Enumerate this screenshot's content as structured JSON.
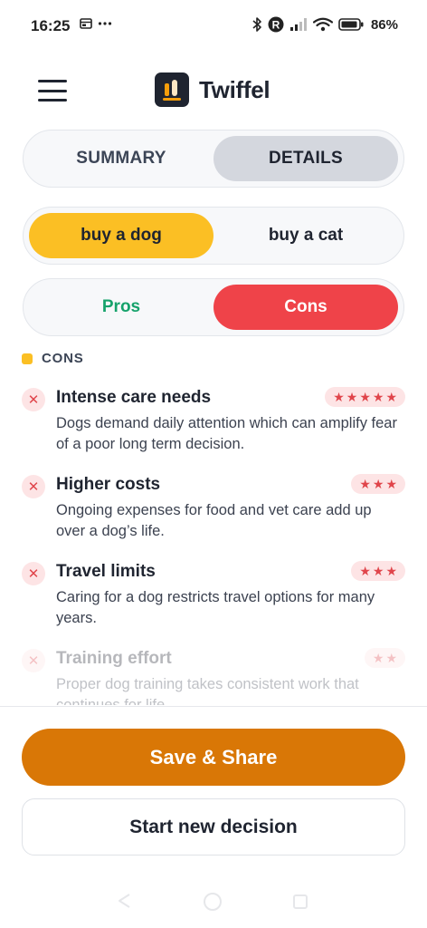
{
  "status_bar": {
    "time": "16:25",
    "battery": "86%"
  },
  "header": {
    "app_title": "Twiffel"
  },
  "tabs": {
    "summary_label": "SUMMARY",
    "details_label": "DETAILS",
    "selected": "DETAILS"
  },
  "options": {
    "option_a": "buy a dog",
    "option_b": "buy a cat",
    "selected": "buy a dog"
  },
  "pros_cons": {
    "pros_label": "Pros",
    "cons_label": "Cons",
    "selected": "Cons"
  },
  "section": {
    "label": "CONS"
  },
  "cons": [
    {
      "title": "Intense care needs",
      "description": "Dogs demand daily attention which can amplify fear of a poor long term decision.",
      "stars": "★★★★★",
      "rating": 5
    },
    {
      "title": "Higher costs",
      "description": "Ongoing expenses for food and vet care add up over a dog’s life.",
      "stars": "★★★",
      "rating": 3
    },
    {
      "title": "Travel limits",
      "description": "Caring for a dog restricts travel options for many years.",
      "stars": "★★★",
      "rating": 3
    },
    {
      "title": "Training effort",
      "description": "Proper dog training takes consistent work that continues for life.",
      "stars": "★★",
      "rating": 2
    }
  ],
  "actions": {
    "save_label": "Save & Share",
    "new_decision_label": "Start new decision"
  },
  "colors": {
    "accent_yellow": "#fbbf24",
    "cons_red": "#ef4349",
    "pros_green": "#16a26b",
    "save_orange": "#d97706",
    "dark": "#1f2430"
  },
  "icons": {
    "menu": "hamburger-menu-icon",
    "logo": "twiffel-logo-icon",
    "con_marker": "x-icon",
    "rating": "star-icon"
  }
}
